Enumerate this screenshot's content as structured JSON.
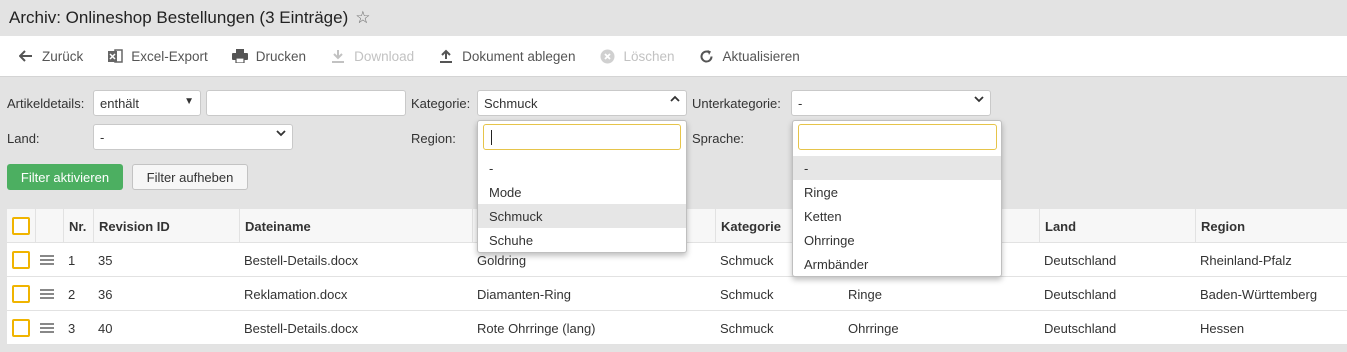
{
  "window": {
    "title": "Archiv: Onlineshop Bestellungen (3 Einträge)",
    "star_icon": "star-outline-icon"
  },
  "toolbar": {
    "buttons": [
      {
        "label": "Zurück",
        "icon": "arrow-left-icon",
        "enabled": true
      },
      {
        "label": "Excel-Export",
        "icon": "excel-icon",
        "enabled": true
      },
      {
        "label": "Drucken",
        "icon": "printer-icon",
        "enabled": true
      },
      {
        "label": "Download",
        "icon": "download-icon",
        "enabled": false
      },
      {
        "label": "Dokument ablegen",
        "icon": "upload-icon",
        "enabled": true
      },
      {
        "label": "Löschen",
        "icon": "delete-icon",
        "enabled": false
      },
      {
        "label": "Aktualisieren",
        "icon": "refresh-icon",
        "enabled": true
      }
    ]
  },
  "filters": {
    "artikeldetails": {
      "label": "Artikeldetails:",
      "operator": "enthält",
      "value": ""
    },
    "kategorie": {
      "label": "Kategorie:",
      "value": "Schmuck"
    },
    "unterkategorie": {
      "label": "Unterkategorie:",
      "value": "-"
    },
    "land": {
      "label": "Land:",
      "value": "-"
    },
    "region": {
      "label": "Region:"
    },
    "sprache": {
      "label": "Sprache:"
    },
    "apply_label": "Filter aktivieren",
    "clear_label": "Filter aufheben"
  },
  "kategorie_dropdown": {
    "search": "",
    "options": [
      "-",
      "Mode",
      "Schmuck",
      "Schuhe"
    ],
    "highlighted": "Schmuck"
  },
  "unterkategorie_dropdown": {
    "search": "",
    "options": [
      "-",
      "Ringe",
      "Ketten",
      "Ohrringe",
      "Armbänder"
    ],
    "highlighted": "-"
  },
  "table": {
    "headers": {
      "nr": "Nr.",
      "revision": "Revision ID",
      "dateiname": "Dateiname",
      "kategorie": "Kategorie",
      "land": "Land",
      "region": "Region"
    },
    "rows": [
      {
        "nr": "1",
        "revision": "35",
        "dateiname": "Bestell-Details.docx",
        "artikel": "Goldring",
        "kategorie": "Schmuck",
        "unterkategorie": "",
        "land": "Deutschland",
        "region": "Rheinland-Pfalz"
      },
      {
        "nr": "2",
        "revision": "36",
        "dateiname": "Reklamation.docx",
        "artikel": "Diamanten-Ring",
        "kategorie": "Schmuck",
        "unterkategorie": "Ringe",
        "land": "Deutschland",
        "region": "Baden-Württemberg"
      },
      {
        "nr": "3",
        "revision": "40",
        "dateiname": "Bestell-Details.docx",
        "artikel": "Rote Ohrringe (lang)",
        "kategorie": "Schmuck",
        "unterkategorie": "Ohrringe",
        "land": "Deutschland",
        "region": "Hessen"
      }
    ]
  },
  "colors": {
    "accent_green": "#4caf61",
    "checkbox_border": "#f0b400"
  }
}
